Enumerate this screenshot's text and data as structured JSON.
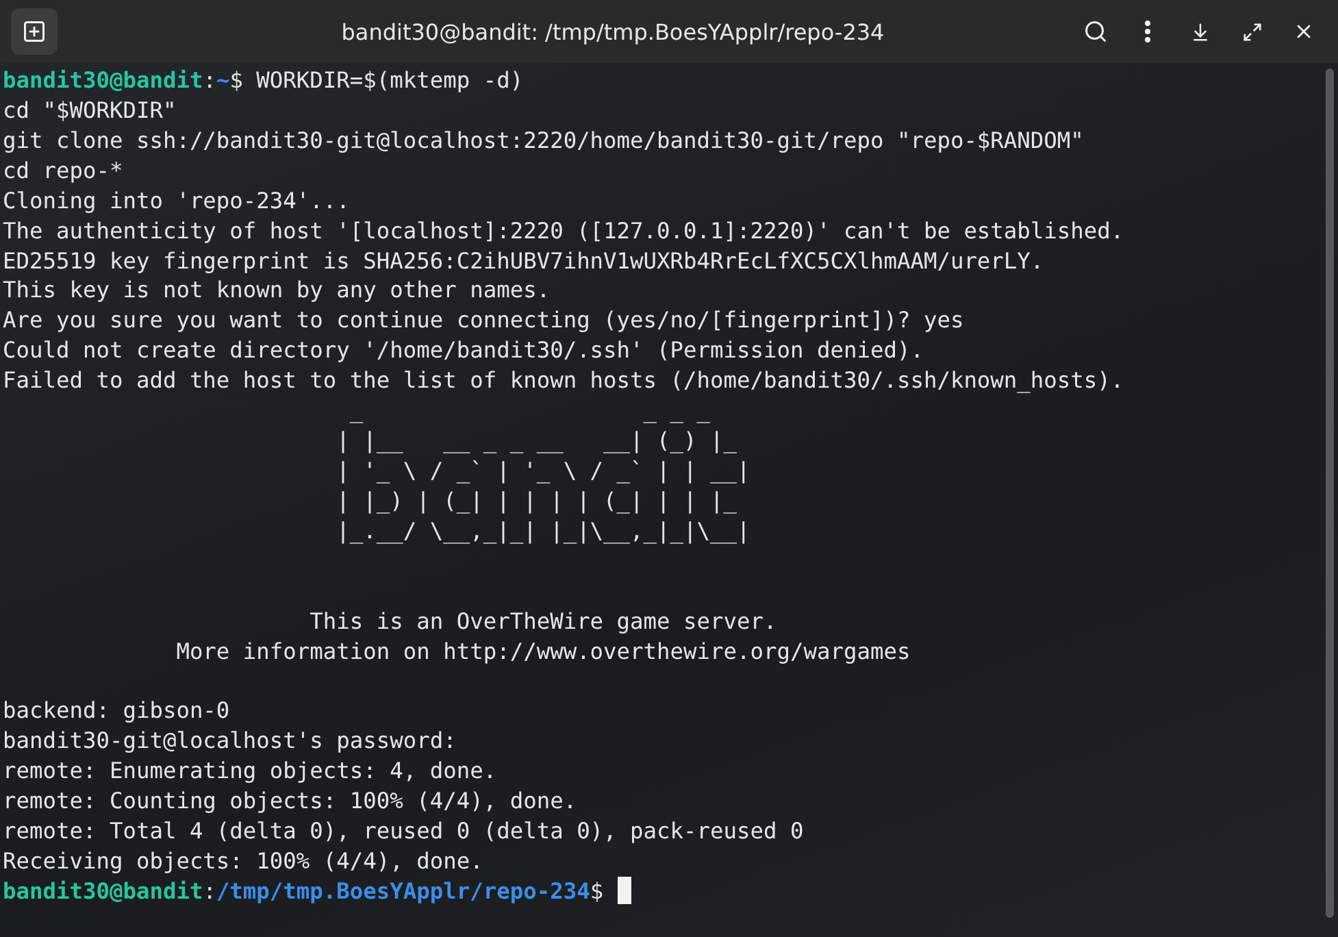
{
  "window": {
    "title": "bandit30@bandit: /tmp/tmp.BoesYApplr/repo-234"
  },
  "lines": [
    {
      "kind": "prompt",
      "user_host": "bandit30@bandit",
      "separator": ":",
      "path": "~",
      "symbol": "$",
      "command": "WORKDIR=$(mktemp -d)"
    },
    {
      "kind": "output",
      "text": "cd \"$WORKDIR\""
    },
    {
      "kind": "output",
      "text": "git clone ssh://bandit30-git@localhost:2220/home/bandit30-git/repo \"repo-$RANDOM\""
    },
    {
      "kind": "output",
      "text": "cd repo-*"
    },
    {
      "kind": "output",
      "text": "Cloning into 'repo-234'..."
    },
    {
      "kind": "output",
      "text": "The authenticity of host '[localhost]:2220 ([127.0.0.1]:2220)' can't be established."
    },
    {
      "kind": "output",
      "text": "ED25519 key fingerprint is SHA256:C2ihUBV7ihnV1wUXRb4RrEcLfXC5CXlhmAAM/urerLY."
    },
    {
      "kind": "output",
      "text": "This key is not known by any other names."
    },
    {
      "kind": "output",
      "text": "Are you sure you want to continue connecting (yes/no/[fingerprint])? yes"
    },
    {
      "kind": "output",
      "text": "Could not create directory '/home/bandit30/.ssh' (Permission denied)."
    },
    {
      "kind": "output",
      "text": "Failed to add the host to the list of known hosts (/home/bandit30/.ssh/known_hosts)."
    },
    {
      "kind": "art",
      "text": "                          _                     _ _ _"
    },
    {
      "kind": "art",
      "text": "                         | |__   __ _ _ __   __| (_) |_"
    },
    {
      "kind": "art",
      "text": "                         | '_ \\ / _` | '_ \\ / _` | | __|"
    },
    {
      "kind": "art",
      "text": "                         | |_) | (_| | | | | (_| | | |_"
    },
    {
      "kind": "art",
      "text": "                         |_.__/ \\__,_|_| |_|\\__,_|_|\\__|"
    },
    {
      "kind": "blank"
    },
    {
      "kind": "blank"
    },
    {
      "kind": "art",
      "text": "                       This is an OverTheWire game server."
    },
    {
      "kind": "art",
      "text": "             More information on http://www.overthewire.org/wargames"
    },
    {
      "kind": "blank"
    },
    {
      "kind": "output",
      "text": "backend: gibson-0"
    },
    {
      "kind": "output",
      "text": "bandit30-git@localhost's password:"
    },
    {
      "kind": "output",
      "text": "remote: Enumerating objects: 4, done."
    },
    {
      "kind": "output",
      "text": "remote: Counting objects: 100% (4/4), done."
    },
    {
      "kind": "output",
      "text": "remote: Total 4 (delta 0), reused 0 (delta 0), pack-reused 0"
    },
    {
      "kind": "output",
      "text": "Receiving objects: 100% (4/4), done."
    },
    {
      "kind": "prompt",
      "user_host": "bandit30@bandit",
      "separator": ":",
      "path": "/tmp/tmp.BoesYApplr/repo-234",
      "symbol": "$",
      "cursor": true
    }
  ]
}
